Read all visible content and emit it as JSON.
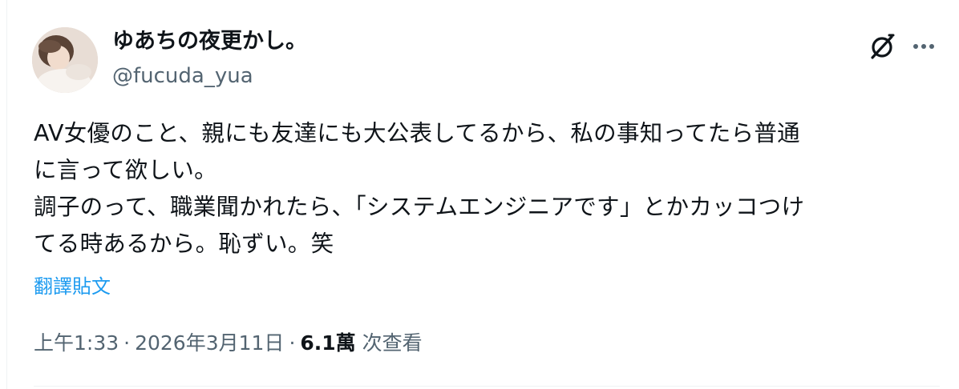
{
  "tweet": {
    "display_name": "ゆあちの夜更かし。",
    "handle": "@fucuda_yua",
    "avatar_icon": "profile-photo",
    "grok_icon": "grok-icon",
    "more_icon": "more-horizontal-icon",
    "text_lines": [
      "AV女優のこと、親にも友達にも大公表してるから、私の事知ってたら普通",
      "に言って欲しい。",
      "調子のって、職業聞かれたら、「システムエンジニアです」とかカッコつけ",
      "てる時あるから。恥ずい。笑"
    ],
    "translate_label": "翻譯貼文",
    "time": "上午1:33",
    "date": "2026年3月11日",
    "separator": "·",
    "views_count": "6.1萬",
    "views_label": "次查看",
    "accent_color": "#1d9bf0",
    "secondary_text_color": "#536471"
  }
}
